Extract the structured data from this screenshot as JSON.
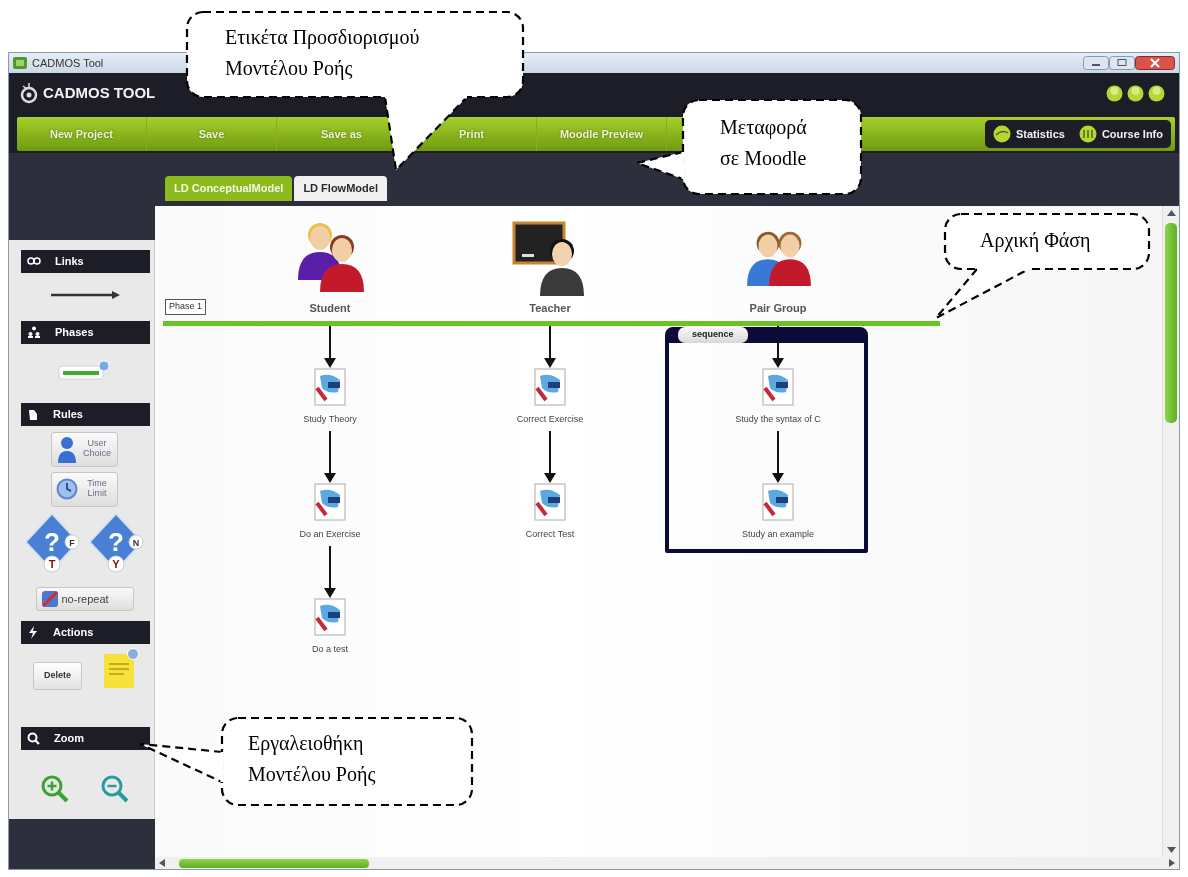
{
  "window": {
    "title": "CADMOS Tool"
  },
  "header": {
    "logo": "CADMOS TOOL"
  },
  "toolbar": {
    "buttons": [
      {
        "label": "New Project"
      },
      {
        "label": "Save"
      },
      {
        "label": "Save as"
      },
      {
        "label": "Print"
      },
      {
        "label": "Moodle Preview"
      }
    ],
    "panel_buttons": [
      {
        "label": "Statistics"
      },
      {
        "label": "Course Info"
      }
    ]
  },
  "tabs": [
    {
      "label": "LD ConceptualModel",
      "selected": false
    },
    {
      "label": "LD FlowModel",
      "selected": true
    }
  ],
  "palette": [
    {
      "title": "Links",
      "items": [
        {
          "kind": "arrow"
        }
      ]
    },
    {
      "title": "Phases",
      "items": [
        {
          "kind": "phase"
        }
      ]
    },
    {
      "title": "Rules",
      "items": [
        {
          "kind": "choice-rule",
          "label": "User Choice"
        },
        {
          "kind": "time-rule",
          "label": "Time Limit"
        },
        {
          "kind": "condition",
          "mark": "?",
          "side": "F",
          "bottom": "T"
        },
        {
          "kind": "condition",
          "mark": "?",
          "side": "N",
          "bottom": "Y"
        },
        {
          "kind": "repeat-rule",
          "label": "no-repeat"
        }
      ]
    },
    {
      "title": "Actions",
      "items": [
        {
          "kind": "button",
          "label": "Delete"
        },
        {
          "kind": "note"
        }
      ]
    },
    {
      "title": "Zoom",
      "items": [
        {
          "kind": "zoom-in"
        },
        {
          "kind": "zoom-out"
        }
      ]
    }
  ],
  "diagram": {
    "phase": {
      "label": "Phase 1"
    },
    "roles": [
      {
        "name": "Student",
        "kind": "students",
        "activities": [
          "Study Theory",
          "Do an Exercise",
          "Do a test"
        ]
      },
      {
        "name": "Teacher",
        "kind": "teacher",
        "activities": [
          "Correct Exercise",
          "Correct Test"
        ]
      },
      {
        "name": "Pair Group",
        "kind": "pair",
        "group": "sequence",
        "activities": [
          "Study the syntax of C",
          "Study an example"
        ]
      }
    ]
  },
  "callouts": [
    {
      "lines": [
        "Ετικέτα Προσδιορισμού",
        "Μοντέλου Ροής"
      ]
    },
    {
      "lines": [
        "Μεταφορά",
        "σε Moodle"
      ]
    },
    {
      "lines": [
        "Αρχική Φάση"
      ]
    },
    {
      "lines": [
        "Εργαλειοθήκη",
        "Μοντέλου Ροής"
      ]
    }
  ]
}
